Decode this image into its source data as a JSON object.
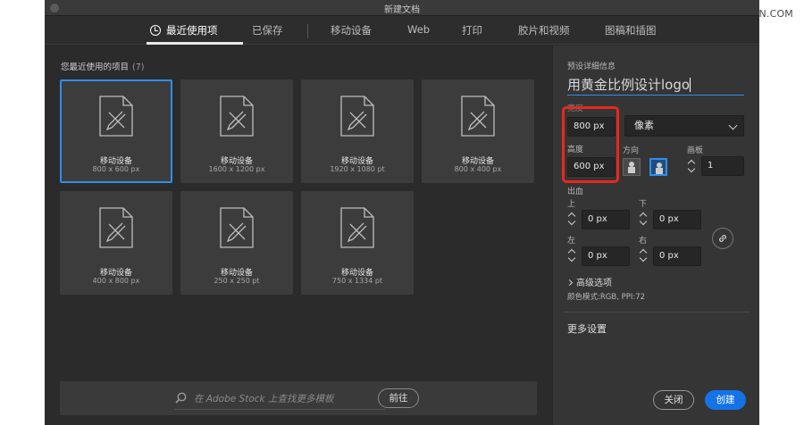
{
  "watermark": "思缘设计论坛 WWW.MISSYUAN.COM",
  "window": {
    "title": "新建文档"
  },
  "tabs": [
    {
      "label": "最近使用项",
      "active": true
    },
    {
      "label": "已保存"
    },
    {
      "label": "移动设备"
    },
    {
      "label": "Web"
    },
    {
      "label": "打印"
    },
    {
      "label": "胶片和视频"
    },
    {
      "label": "图稿和插图"
    }
  ],
  "recent": {
    "title": "您最近使用的项目",
    "count": "(7)",
    "items": [
      {
        "name": "移动设备",
        "size": "800 x 600 px",
        "selected": true
      },
      {
        "name": "移动设备",
        "size": "1600 x 1200 px"
      },
      {
        "name": "移动设备",
        "size": "1920 x 1080 pt"
      },
      {
        "name": "移动设备",
        "size": "800 x 400 px"
      },
      {
        "name": "移动设备",
        "size": "400 x 800 px"
      },
      {
        "name": "移动设备",
        "size": "250 x 250 pt"
      },
      {
        "name": "移动设备",
        "size": "750 x 1334 pt"
      }
    ]
  },
  "stock_search": {
    "placeholder": "在 Adobe Stock 上查找更多模板",
    "go_label": "前往"
  },
  "details": {
    "header": "预设详细信息",
    "preset_name": "用黄金比例设计logo",
    "width_label": "宽度",
    "width_value": "800 px",
    "unit": "像素",
    "height_label": "高度",
    "height_value": "600 px",
    "orientation_label": "方向",
    "artboards_label": "画板",
    "artboards_value": "1",
    "bleed_label": "出血",
    "bleed": {
      "top_label": "上",
      "top_value": "0 px",
      "bottom_label": "下",
      "bottom_value": "0 px",
      "left_label": "左",
      "left_value": "0 px",
      "right_label": "右",
      "right_value": "0 px"
    },
    "advanced_label": "高级选项",
    "color_mode": "颜色模式:RGB, PPI:72",
    "more_settings": "更多设置",
    "close_label": "关闭",
    "create_label": "创建"
  },
  "colors": {
    "accent": "#2f8eed",
    "primary_button": "#1473e6",
    "highlight": "#e8271f"
  }
}
